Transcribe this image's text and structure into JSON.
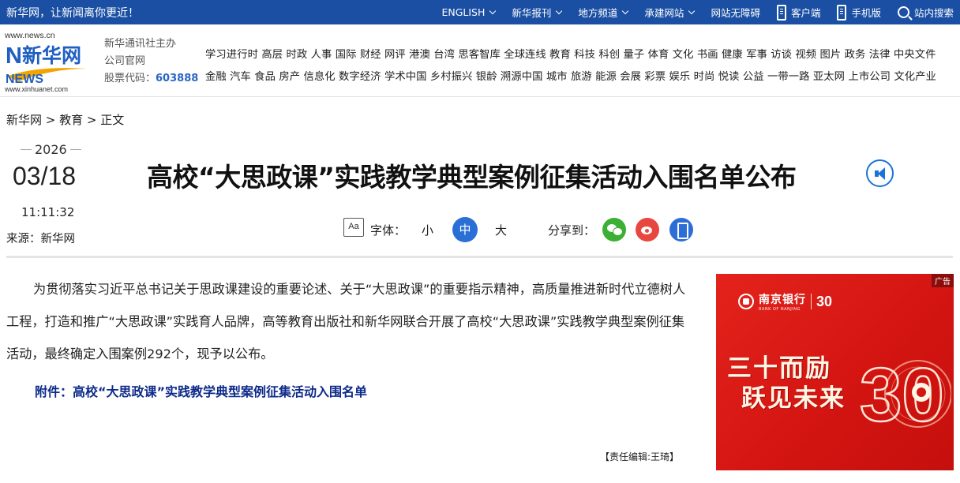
{
  "topbar": {
    "slogan": "新华网，让新闻离你更近！",
    "nav": [
      {
        "label": "ENGLISH",
        "dropdown": true
      },
      {
        "label": "新华报刊",
        "dropdown": true
      },
      {
        "label": "地方频道",
        "dropdown": true
      },
      {
        "label": "承建网站",
        "dropdown": true
      },
      {
        "label": "网站无障碍",
        "dropdown": false
      }
    ],
    "client": "客户端",
    "mobile": "手机版",
    "search": "站内搜索"
  },
  "header": {
    "logo_url_top": "www.news.cn",
    "logo_url_bottom": "www.xinhuanet.com",
    "logo_cn": "新华网",
    "logo_en": "NEWS",
    "org_line1": "新华通讯社主办",
    "org_line2": "公司官网",
    "stock_label": "股票代码：",
    "stock_code": "603888",
    "channels_row1": [
      "学习进行时",
      "高层",
      "时政",
      "人事",
      "国际",
      "财经",
      "网评",
      "港澳",
      "台湾",
      "思客智库",
      "全球连线",
      "教育",
      "科技",
      "科创",
      "量子",
      "体育",
      "文化",
      "书画",
      "健康",
      "军事",
      "访谈",
      "视频",
      "图片",
      "政务",
      "法律",
      "中央文件"
    ],
    "channels_row2": [
      "金融",
      "汽车",
      "食品",
      "房产",
      "信息化",
      "数字经济",
      "学术中国",
      "乡村振兴",
      "银龄",
      "溯源中国",
      "城市",
      "旅游",
      "能源",
      "会展",
      "彩票",
      "娱乐",
      "时尚",
      "悦读",
      "公益",
      "一带一路",
      "亚太网",
      "上市公司",
      "文化产业"
    ]
  },
  "breadcrumb": {
    "home": "新华网",
    "sep": " > ",
    "section": "教育",
    "current": "正文"
  },
  "meta": {
    "year": "2026",
    "month_day": "03/18",
    "time": "11:11:32",
    "source": "来源：新华网"
  },
  "title": "高校“大思政课”实践教学典型案例征集活动入围名单公布",
  "tools": {
    "font_icon": "Aa",
    "font_label": "字体：",
    "sizes": [
      "小",
      "中",
      "大"
    ],
    "active_size": "中",
    "share_label": "分享到："
  },
  "article": {
    "paragraph": "为贯彻落实习近平总书记关于思政课建设的重要论述、关于“大思政课”的重要指示精神，高质量推进新时代立德树人工程，打造和推广“大思政课”实践育人品牌，高等教育出版社和新华网联合开展了高校“大思政课”实践教学典型案例征集活动，最终确定入围案例292个，现予以公布。",
    "attachment": "附件：高校“大思政课”实践教学典型案例征集活动入围名单",
    "editor": "【责任编辑:王琦】"
  },
  "ad": {
    "tag": "广告",
    "bank_name": "南京银行",
    "bank_en": "BANK OF NANJING",
    "anniv": "30",
    "slogan1": "三十而励",
    "slogan2": "跃见未来",
    "big_number": "30"
  },
  "colors": {
    "topbar": "#1a4fa3",
    "accent": "#2a6fd6",
    "attachment": "#0d2a8a",
    "ad_red": "#d41512"
  },
  "icons": [
    "chevron-down-icon",
    "client-app-icon",
    "mobile-icon",
    "search-icon",
    "speaker-icon",
    "font-size-icon",
    "wechat-icon",
    "weibo-icon",
    "mobile-share-icon"
  ]
}
